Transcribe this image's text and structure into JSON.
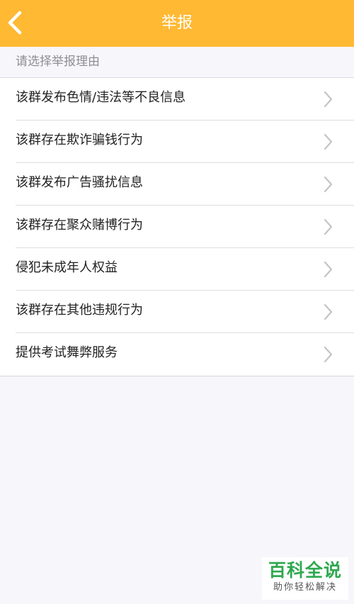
{
  "header": {
    "title": "举报",
    "back_icon": "chevron-left-icon",
    "background_color": "#ffb933"
  },
  "section": {
    "title": "请选择举报理由"
  },
  "reasons": [
    {
      "label": "该群发布色情/违法等不良信息"
    },
    {
      "label": "该群存在欺诈骗钱行为"
    },
    {
      "label": "该群发布广告骚扰信息"
    },
    {
      "label": "该群存在聚众赌博行为"
    },
    {
      "label": "侵犯未成年人权益"
    },
    {
      "label": "该群存在其他违规行为"
    },
    {
      "label": "提供考试舞弊服务"
    }
  ],
  "watermark": {
    "main": "百科全说",
    "sub": "助你轻松解决",
    "color": "#2fa84f"
  }
}
